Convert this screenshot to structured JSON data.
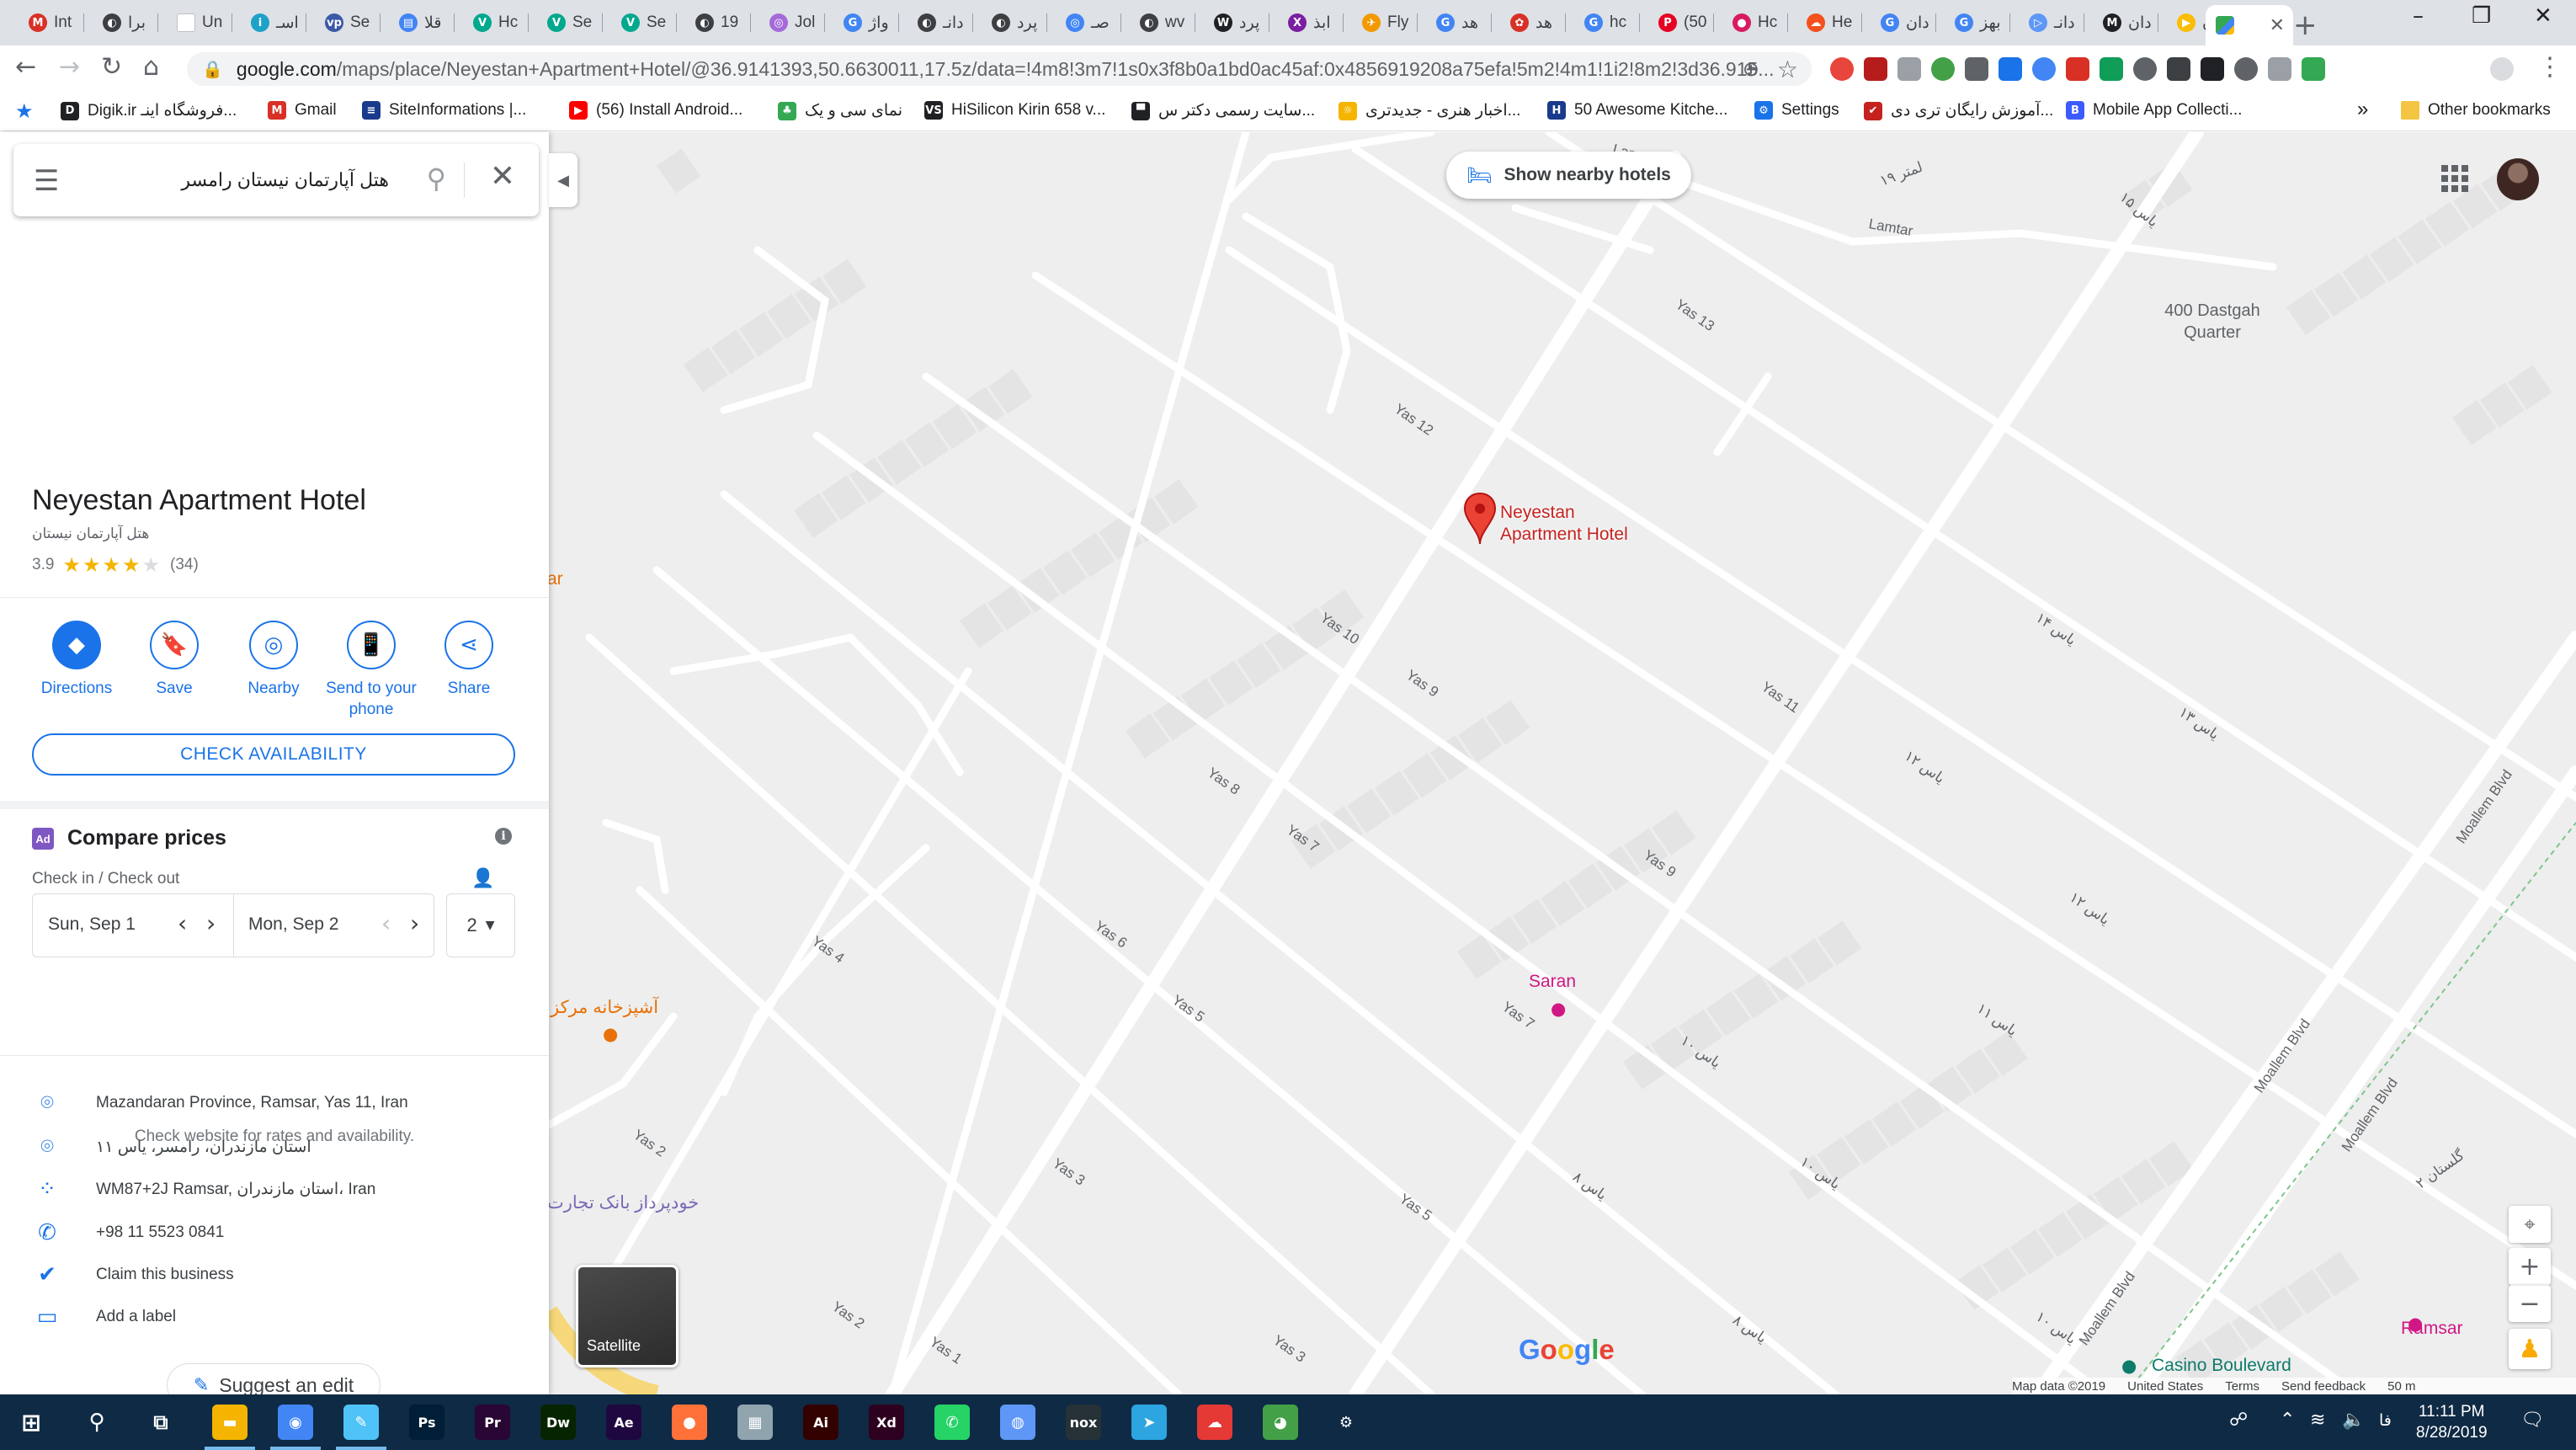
{
  "browser": {
    "tabs": [
      {
        "title": "Int",
        "color": "#d93025",
        "glyph": "M"
      },
      {
        "title": "برا",
        "color": "#3c4043",
        "glyph": "◐"
      },
      {
        "title": "Un",
        "color": "#ffffff",
        "glyph": ""
      },
      {
        "title": "اسـ",
        "color": "#1da1c9",
        "glyph": "i"
      },
      {
        "title": "Se",
        "color": "#3b59a8",
        "glyph": "vp"
      },
      {
        "title": "قلا",
        "color": "#4285f4",
        "glyph": "▤"
      },
      {
        "title": "Hc",
        "color": "#00a88e",
        "glyph": "V"
      },
      {
        "title": "Se",
        "color": "#00a88e",
        "glyph": "V"
      },
      {
        "title": "Se",
        "color": "#00a88e",
        "glyph": "V"
      },
      {
        "title": "19",
        "color": "#3c4043",
        "glyph": "◐"
      },
      {
        "title": "Jol",
        "color": "#a56ad9",
        "glyph": "◎"
      },
      {
        "title": "واژ",
        "color": "#4285f4",
        "glyph": "G"
      },
      {
        "title": "دانـ",
        "color": "#3c4043",
        "glyph": "◐"
      },
      {
        "title": "پرد",
        "color": "#3c4043",
        "glyph": "◐"
      },
      {
        "title": "صـ",
        "color": "#4285f4",
        "glyph": "◎"
      },
      {
        "title": "wv",
        "color": "#3c4043",
        "glyph": "◐"
      },
      {
        "title": "پرد",
        "color": "#202124",
        "glyph": "W"
      },
      {
        "title": "ابذ",
        "color": "#7b1fa2",
        "glyph": "X"
      },
      {
        "title": "Fly",
        "color": "#f29900",
        "glyph": "✈"
      },
      {
        "title": "هد",
        "color": "#4285f4",
        "glyph": "G"
      },
      {
        "title": "هد",
        "color": "#d93025",
        "glyph": "✿"
      },
      {
        "title": "hc",
        "color": "#4285f4",
        "glyph": "G"
      },
      {
        "title": "(50",
        "color": "#e60023",
        "glyph": "P"
      },
      {
        "title": "Hc",
        "color": "#d81b60",
        "glyph": "●"
      },
      {
        "title": "He",
        "color": "#f4511e",
        "glyph": "☁"
      },
      {
        "title": "دان",
        "color": "#4285f4",
        "glyph": "G"
      },
      {
        "title": "بهز",
        "color": "#4285f4",
        "glyph": "G"
      },
      {
        "title": "دانـ",
        "color": "#5e97f6",
        "glyph": "▷"
      },
      {
        "title": "دان",
        "color": "#202124",
        "glyph": "M"
      },
      {
        "title": "دان",
        "color": "#fbbc04",
        "glyph": "▶"
      }
    ],
    "active_tab_icon": "google-maps-icon",
    "url_host": "google.com",
    "url_path": "/maps/place/Neyestan+Apartment+Hotel/@36.9141393,50.6630011,17.5z/data=!4m8!3m7!1s0x3f8b0a1bd0ac45af:0x4856919208a75efa!5m2!4m1!1i2!8m2!3d36.915...",
    "bookmarks": [
      {
        "label": "Digik.ir فروشگاه اینـ...",
        "color": "#202124",
        "glyph": "D"
      },
      {
        "label": "Gmail",
        "color": "#d93025",
        "glyph": "M"
      },
      {
        "label": "SiteInformations |...",
        "color": "#1a3a8c",
        "glyph": "≡"
      },
      {
        "label": "(56) Install Android...",
        "color": "#ff0000",
        "glyph": "▶"
      },
      {
        "label": "نمای سی و یک",
        "color": "#34a853",
        "glyph": "♣"
      },
      {
        "label": "HiSilicon Kirin 658 v...",
        "color": "#202124",
        "glyph": "VS"
      },
      {
        "label": "سایت رسمی دکتر س...",
        "color": "#202124",
        "glyph": "▀"
      },
      {
        "label": "اخبار هنری - جدیدتری...",
        "color": "#f4b400",
        "glyph": "☼"
      },
      {
        "label": "50 Awesome Kitche...",
        "color": "#1a3a8c",
        "glyph": "H"
      },
      {
        "label": "Settings",
        "color": "#1a73e8",
        "glyph": "⚙"
      },
      {
        "label": "آموزش رایگان تری دی...",
        "color": "#c5221f",
        "glyph": "✔"
      },
      {
        "label": "Mobile App Collecti...",
        "color": "#3d5afe",
        "glyph": "B"
      }
    ],
    "other_bookmarks": "Other bookmarks"
  },
  "search": {
    "query": "هتل آپارتمان نیستان رامسر"
  },
  "place": {
    "name": "Neyestan Apartment Hotel",
    "alt_name": "هتل آپارتمان نیستان",
    "rating": "3.9",
    "reviews": "(34)",
    "stars_filled": 4
  },
  "actions": [
    {
      "label": "Directions",
      "icon": "directions-icon",
      "glyph": "◆"
    },
    {
      "label": "Save",
      "icon": "bookmark-icon",
      "glyph": "🔖"
    },
    {
      "label": "Nearby",
      "icon": "nearby-icon",
      "glyph": "◎"
    },
    {
      "label": "Send to your phone",
      "icon": "phone-send-icon",
      "glyph": "📱"
    },
    {
      "label": "Share",
      "icon": "share-icon",
      "glyph": "⋖"
    }
  ],
  "check_availability": "CHECK AVAILABILITY",
  "compare": {
    "badge": "Ad",
    "title": "Compare prices",
    "checkin_label": "Check in / Check out",
    "checkin": "Sun, Sep 1",
    "checkout": "Mon, Sep 2",
    "guests": "2",
    "note": "Check website for rates and availability."
  },
  "info": [
    {
      "icon": "location-pin-icon",
      "glyph": "⌾",
      "text": "Mazandaran Province, Ramsar, Yas 11, Iran"
    },
    {
      "icon": "location-pin-icon",
      "glyph": "⌾",
      "text": "استان مازندران، رامسر، یاس ۱۱"
    },
    {
      "icon": "plus-code-icon",
      "glyph": "⁘",
      "text": "WM87+2J Ramsar, استان مازندران، Iran"
    },
    {
      "icon": "phone-icon",
      "glyph": "✆",
      "text": "+98 11 5523 0841"
    },
    {
      "icon": "verified-icon",
      "glyph": "✔",
      "text": "Claim this business"
    },
    {
      "icon": "label-icon",
      "glyph": "▭",
      "text": "Add a label"
    }
  ],
  "suggest_edit": "Suggest an edit",
  "map": {
    "nearby_hotels": "Show nearby hotels",
    "pin_label_line1": "Neyestan",
    "pin_label_line2": "Apartment Hotel",
    "satellite": "Satellite",
    "google": "Google",
    "footer": [
      "Map data ©2019",
      "United States",
      "Terms",
      "Send feedback",
      "50 m"
    ],
    "streets": [
      "Yas 13",
      "Yas 12",
      "Yas 10",
      "Yas 9",
      "Yas 11",
      "Yas 8",
      "Yas 7",
      "Yas 9",
      "Yas 6",
      "Yas 5",
      "Yas 4",
      "Yas 3",
      "Yas 2",
      "Yas 2",
      "Yas 1",
      "Yas 3",
      "Yas 5",
      "Yas 7",
      "Lamtar",
      "لمتر ۱۹",
      "یاس ۱۵",
      "یاس ۱۴",
      "یاس ۱۳",
      "یاس ۱۲",
      "یاس ۱۲",
      "یاس ۱۱",
      "یاس ۱۰",
      "یاس ۱۰",
      "یاس ۸",
      "یاس ۸",
      "یاس ۱۰",
      "Moallem Blvd",
      "Moallem Blvd",
      "Moallem Blvd",
      "Moallem Blvd",
      "گلستان ۲",
      "Lamtar"
    ],
    "pois": [
      {
        "name": "400 Dastgah Quarter",
        "color": "#5f6368"
      },
      {
        "name": "Saran",
        "color": "#d01884"
      },
      {
        "name": "آشپزخانه مرکز",
        "color": "#e8710a"
      },
      {
        "name": "خودپرداز بانک تجارت",
        "color": "#7b68b6"
      },
      {
        "name": "Casino Boulevard",
        "color": "#0f7b6c"
      },
      {
        "name": "Ramsar",
        "color": "#d01884"
      },
      {
        "name": "ar",
        "color": "#e8710a"
      }
    ]
  },
  "taskbar": {
    "time": "11:11 PM",
    "date": "8/28/2019",
    "lang": "فا",
    "apps": [
      {
        "name": "file-explorer-icon",
        "color": "#f4b400",
        "glyph": "▬"
      },
      {
        "name": "chrome-icon",
        "color": "#4285f4",
        "glyph": "◉"
      },
      {
        "name": "notepad-icon",
        "color": "#4fc3f7",
        "glyph": "✎"
      },
      {
        "name": "photoshop-icon",
        "color": "#001e36",
        "glyph": "Ps"
      },
      {
        "name": "premiere-icon",
        "color": "#2a0634",
        "glyph": "Pr"
      },
      {
        "name": "dreamweaver-icon",
        "color": "#072401",
        "glyph": "Dw"
      },
      {
        "name": "after-effects-icon",
        "color": "#1f0740",
        "glyph": "Ae"
      },
      {
        "name": "firefox-icon",
        "color": "#ff7139",
        "glyph": "●"
      },
      {
        "name": "network-icon",
        "color": "#90a4ae",
        "glyph": "▦"
      },
      {
        "name": "illustrator-icon",
        "color": "#330000",
        "glyph": "Ai"
      },
      {
        "name": "xd-icon",
        "color": "#2e001f",
        "glyph": "Xd"
      },
      {
        "name": "whatsapp-icon",
        "color": "#25d366",
        "glyph": "✆"
      },
      {
        "name": "globe-icon",
        "color": "#5e97f6",
        "glyph": "◍"
      },
      {
        "name": "nox-icon",
        "color": "#263238",
        "glyph": "nox"
      },
      {
        "name": "telegram-icon",
        "color": "#2ca5e0",
        "glyph": "➤"
      },
      {
        "name": "chat-app-icon",
        "color": "#e53935",
        "glyph": "☁"
      },
      {
        "name": "paint-icon",
        "color": "#43a047",
        "glyph": "◕"
      },
      {
        "name": "settings-icon",
        "color": "#0f2a44",
        "glyph": "⚙"
      }
    ]
  }
}
